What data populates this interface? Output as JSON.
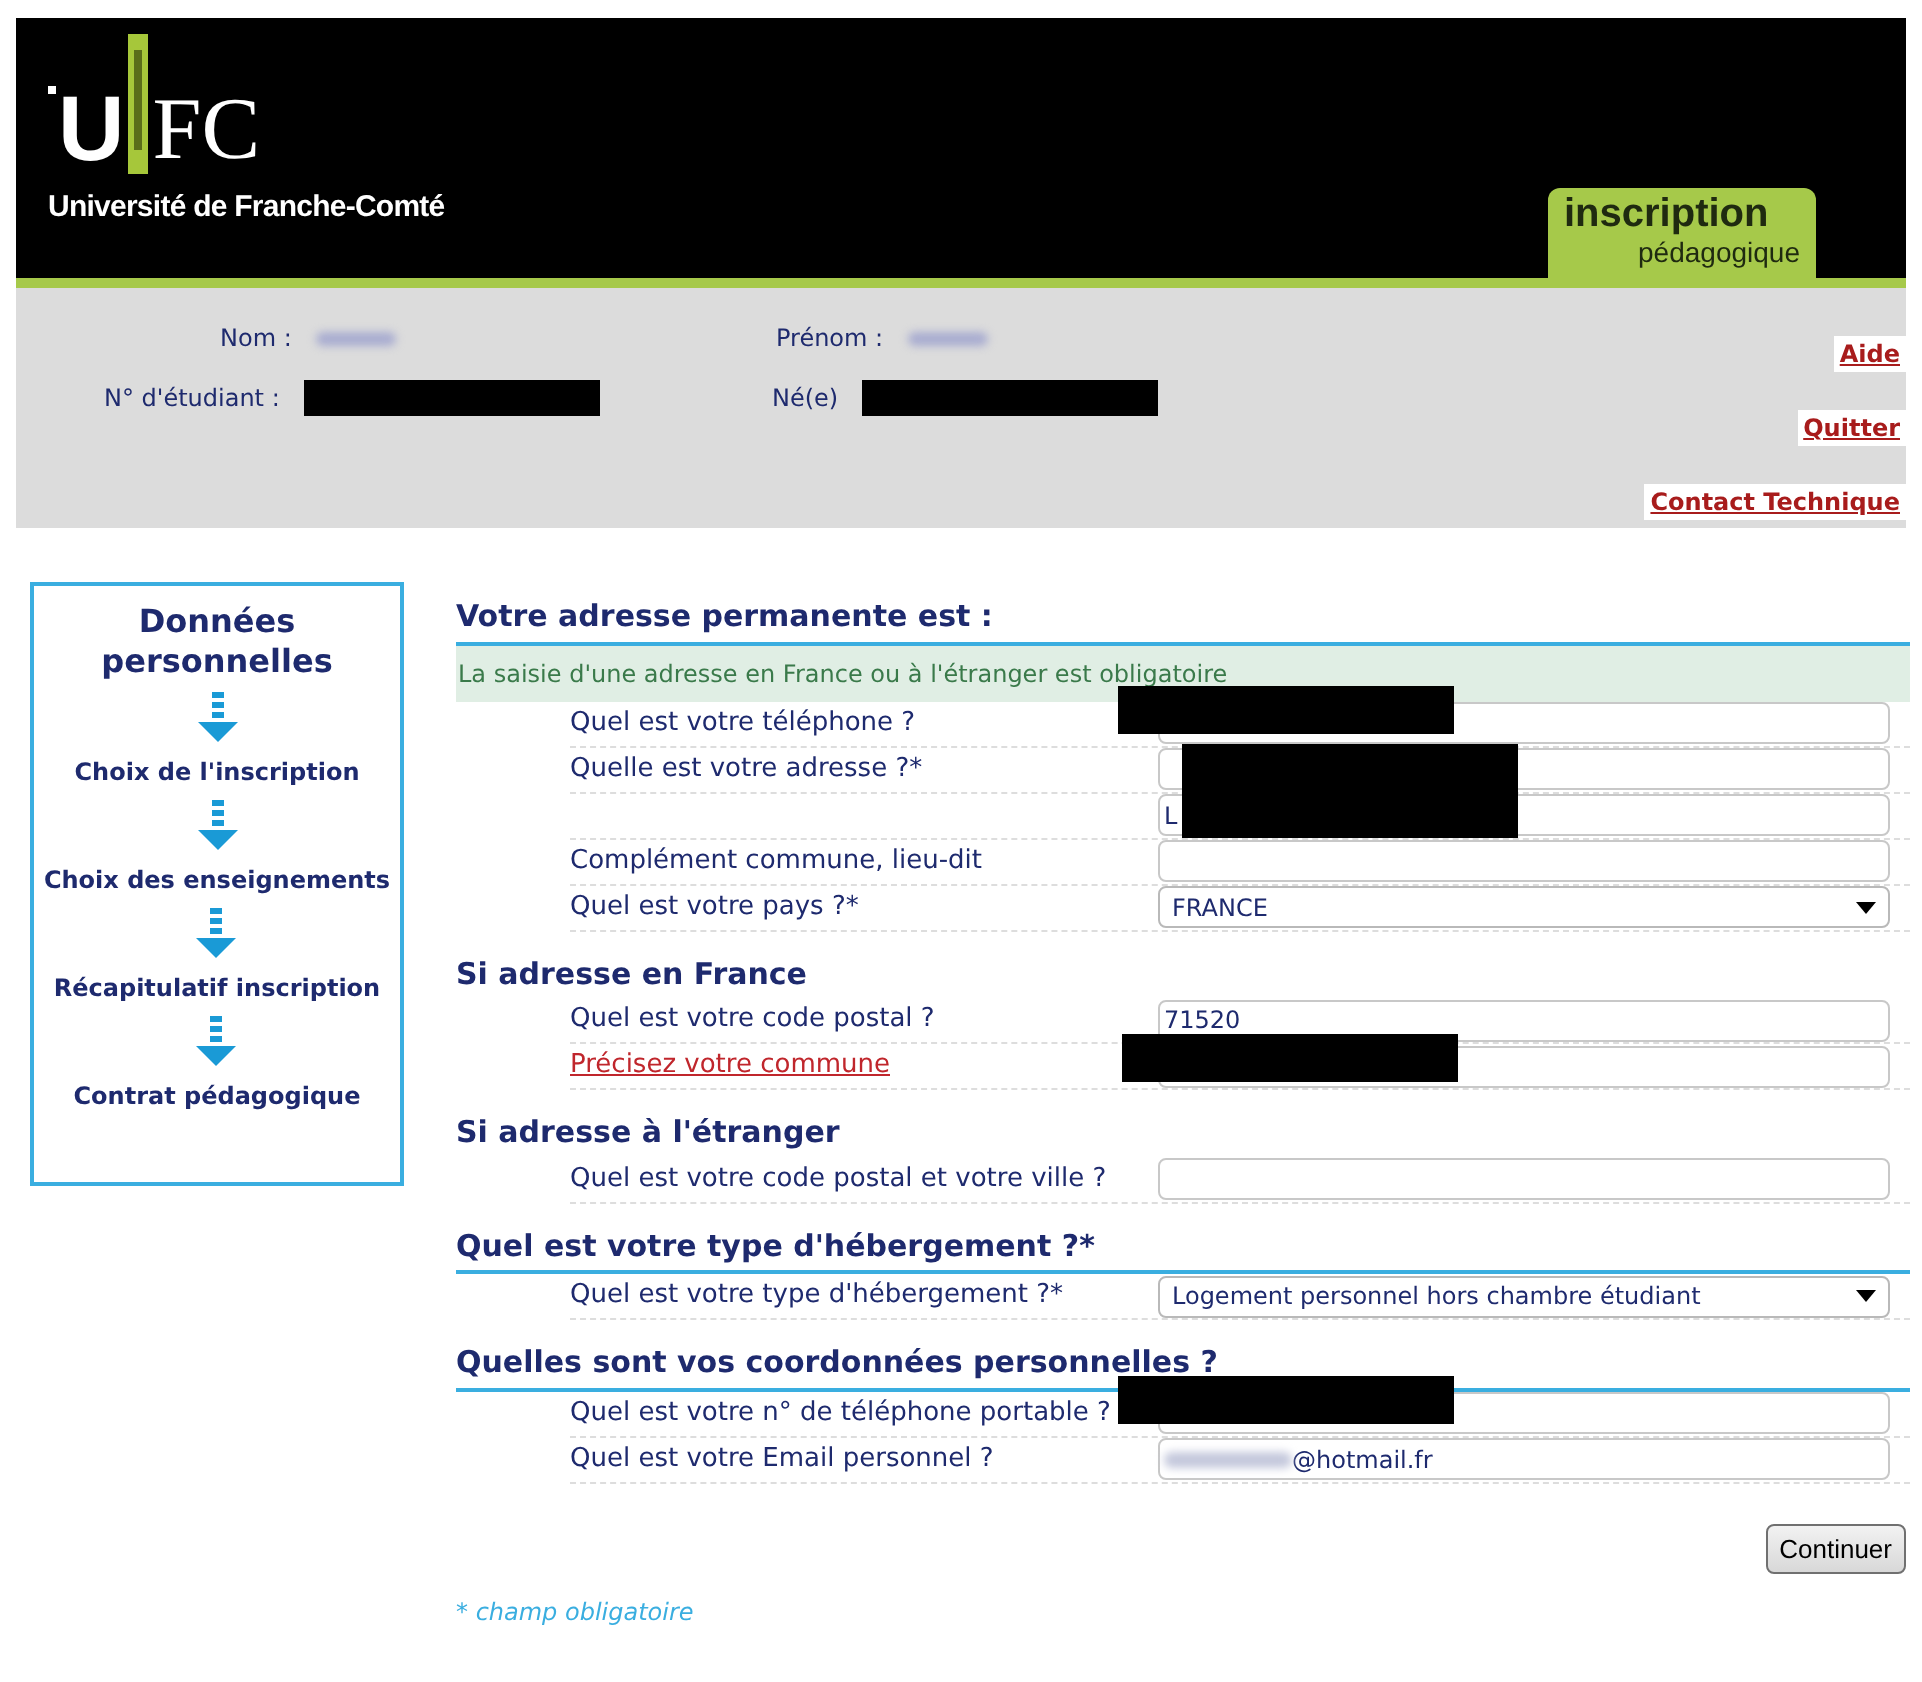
{
  "header": {
    "logo": {
      "letter": "U",
      "letters": "FC",
      "university": "Université de Franche-Comté"
    },
    "tab": {
      "title": "inscription",
      "subtitle": "pédagogique"
    }
  },
  "student": {
    "fields": [
      {
        "label": "Nom :",
        "redacted": false
      },
      {
        "label": "Prénom :",
        "redacted": false
      },
      {
        "label": "N° d'étudiant :",
        "redacted": true
      },
      {
        "label": "Né(e)",
        "redacted": true
      }
    ],
    "links": [
      "Aide",
      "Quitter",
      "Contact Technique"
    ]
  },
  "steps": [
    {
      "label": "Données personnelles",
      "selected": true
    },
    {
      "label": "Choix de l'inscription",
      "selected": false
    },
    {
      "label": "Choix des enseignements",
      "selected": false
    },
    {
      "label": "Récapitulatif inscription",
      "selected": false
    },
    {
      "label": "Contrat pédagogique",
      "selected": false
    }
  ],
  "sections": [
    {
      "title": "Votre adresse permanente est :",
      "note": "La saisie d'une adresse en France ou à l'étranger est obligatoire",
      "underline": true,
      "fields": [
        {
          "label": "Quel est votre téléphone ?",
          "kind": "text",
          "redacted": true
        },
        {
          "label": "Quelle est votre adresse ?*",
          "kind": "text",
          "redacted": true
        },
        {
          "kind": "text",
          "value": "L",
          "redacted": true
        },
        {
          "label": "Complément commune, lieu-dit",
          "kind": "text",
          "redacted": false
        },
        {
          "label": "Quel est votre pays ?*",
          "kind": "select",
          "value": "FRANCE",
          "redacted": false
        }
      ]
    },
    {
      "title": "Si adresse en France",
      "underline": false,
      "fields": [
        {
          "label": "Quel est votre code postal ?",
          "kind": "text",
          "value": "71520",
          "redacted": false
        },
        {
          "label": "Précisez votre commune",
          "kind": "link",
          "redacted": true
        }
      ]
    },
    {
      "title": "Si adresse à l'étranger",
      "underline": false,
      "fields": [
        {
          "label": "Quel est votre code postal et votre ville ?",
          "kind": "text",
          "redacted": false
        }
      ]
    },
    {
      "title": "Quel est votre type d'hébergement ?*",
      "underline": true,
      "fields": [
        {
          "label": "Quel est votre type d'hébergement ?*",
          "kind": "select",
          "value": "Logement personnel hors chambre étudiant",
          "redacted": false
        }
      ]
    },
    {
      "title": "Quelles sont vos coordonnées personnelles ?",
      "underline": true,
      "fields": [
        {
          "label": "Quel est votre n° de téléphone portable ?",
          "kind": "text",
          "redacted": true
        },
        {
          "label": "Quel est votre Email personnel ?",
          "kind": "text",
          "value": "@hotmail.fr",
          "blurred_prefix": true,
          "redacted": false
        }
      ]
    }
  ],
  "button": "Continuer",
  "footnote": "* champ obligatoire"
}
